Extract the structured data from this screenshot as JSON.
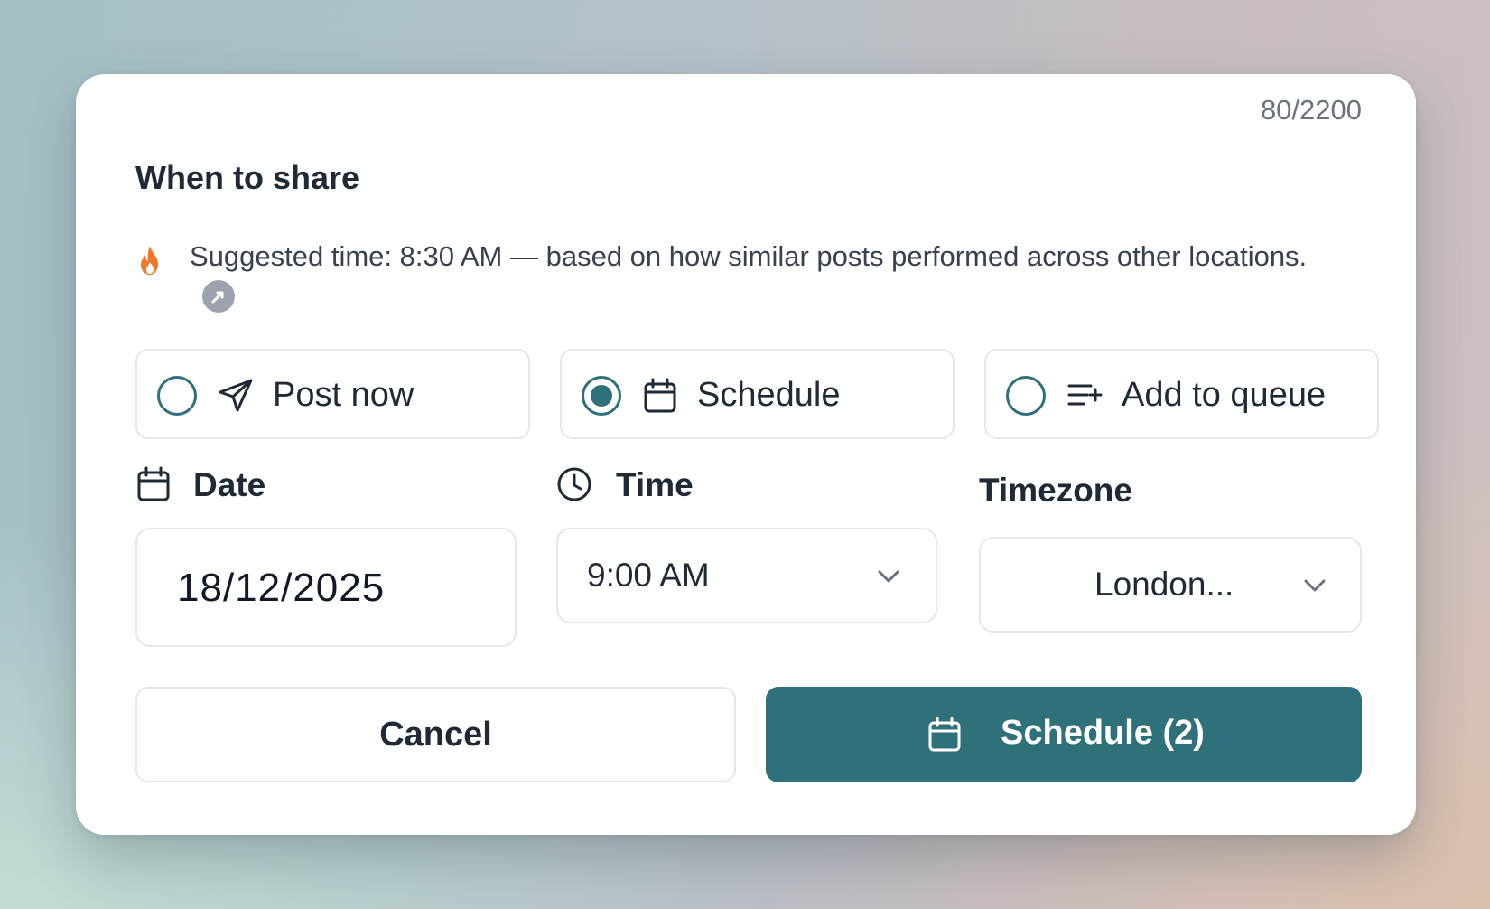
{
  "header": {
    "char_count": "80/2200",
    "title": "When to share"
  },
  "suggestion": {
    "icon": "fire-icon",
    "text": "Suggested time: 8:30 AM — based on how similar posts performed across other locations.",
    "help_icon": "help-icon"
  },
  "share_options": [
    {
      "label": "Post now",
      "icon": "send-icon",
      "selected": false
    },
    {
      "label": "Schedule",
      "icon": "calendar-icon",
      "selected": true
    },
    {
      "label": "Add to queue",
      "icon": "queue-add-icon",
      "selected": false
    }
  ],
  "fields": {
    "date": {
      "label": "Date",
      "icon": "calendar-icon",
      "value": "18/12/2025"
    },
    "time": {
      "label": "Time",
      "icon": "clock-icon",
      "value": "9:00 AM"
    },
    "timezone": {
      "label": "Timezone",
      "value": "London..."
    }
  },
  "actions": {
    "cancel_label": "Cancel",
    "schedule_label": "Schedule (2)"
  },
  "colors": {
    "accent": "#2f717a",
    "fire": "#f07a2a",
    "border": "#e5e7eb",
    "text": "#1f2a37"
  }
}
